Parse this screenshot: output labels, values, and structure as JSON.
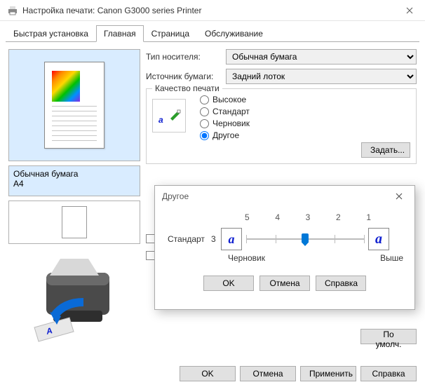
{
  "window": {
    "title": "Настройка печати: Canon G3000 series Printer"
  },
  "tabs": {
    "quick": "Быстрая установка",
    "main": "Главная",
    "page": "Страница",
    "service": "Обслуживание"
  },
  "left": {
    "media": "Обычная бумага",
    "size": "A4"
  },
  "form": {
    "media_label": "Тип носителя:",
    "media_value": "Обычная бумага",
    "source_label": "Источник бумаги:",
    "source_value": "Задний лоток"
  },
  "quality": {
    "legend": "Качество печати",
    "high": "Высокое",
    "standard": "Стандарт",
    "draft": "Черновик",
    "other": "Другое",
    "set": "Задать..."
  },
  "dlg": {
    "title": "Другое",
    "ticks": [
      "5",
      "4",
      "3",
      "2",
      "1"
    ],
    "label": "Стандарт",
    "value": "3",
    "left_cap": "Черновик",
    "right_cap": "Выше",
    "ok": "OK",
    "cancel": "Отмена",
    "help": "Справка"
  },
  "defaults": "По умолч.",
  "footer": {
    "ok": "OK",
    "cancel": "Отмена",
    "apply": "Применить",
    "help": "Справка"
  }
}
